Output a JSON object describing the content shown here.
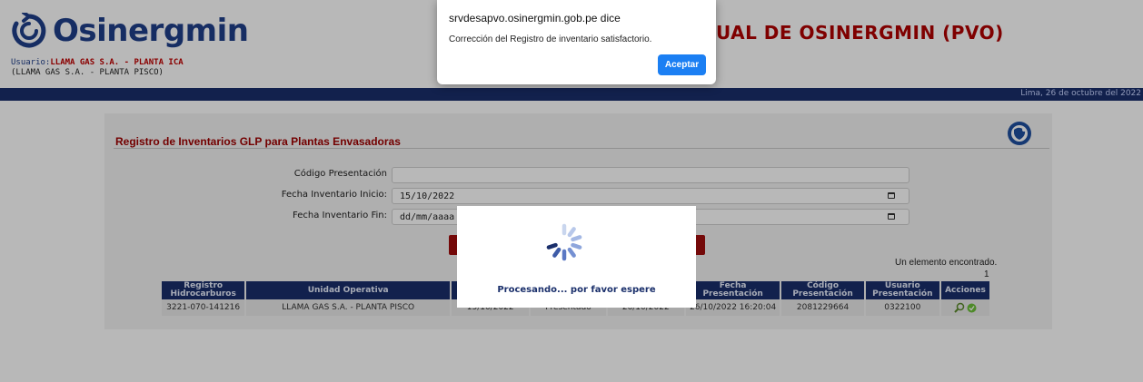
{
  "header": {
    "logo_text": "Osinergmin",
    "user_label": "Usuario:",
    "user_value": "LLAMA GAS S.A. - PLANTA ICA",
    "user_sub": "(LLAMA GAS S.A. - PLANTA PISCO)",
    "app_title": "UAL DE OSINERGMIN (PVO)",
    "date": "Lima, 26 de octubre del 2022"
  },
  "section": {
    "title": "Registro de Inventarios GLP para Plantas Envasadoras"
  },
  "form": {
    "codigo_label": "Código Presentación",
    "codigo_value": "",
    "fecha_inicio_label": "Fecha Inventario Inicio:",
    "fecha_inicio_value": "15/10/2022",
    "fecha_fin_label": "Fecha Inventario Fin:",
    "fecha_fin_value": "dd/mm/aaaa"
  },
  "results": {
    "found_text": "Un elemento encontrado.",
    "count": "1"
  },
  "table": {
    "headers": {
      "registro": "Registro Hidrocarburos",
      "unidad": "Unidad Operativa",
      "fecha_presentacion": "Fecha Presentación",
      "codigo": "Código Presentación",
      "usuario": "Usuario Presentación",
      "acciones": "Acciones"
    },
    "rows": [
      {
        "registro": "3221-070-141216",
        "unidad": "LLAMA GAS S.A. - PLANTA PISCO",
        "fecha_inicio": "15/10/2022",
        "estado": "Presentado",
        "fecha_fin": "26/10/2022",
        "fecha_presentacion": "26/10/2022 16:20:04",
        "codigo": "2081229664",
        "usuario": "0322100"
      }
    ]
  },
  "alert": {
    "title": "srvdesapvo.osinergmin.gob.pe dice",
    "message": "Corrección del Registro de inventario satisfactorio.",
    "button": "Aceptar"
  },
  "loading": {
    "text": "Procesando... por favor espere"
  },
  "colors": {
    "navy": "#1a2f6b",
    "dark_red": "#a10d0d",
    "alert_blue": "#1b7ff3"
  }
}
